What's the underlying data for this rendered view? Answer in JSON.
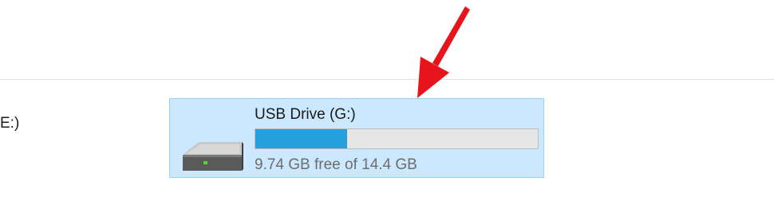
{
  "previous_drive": {
    "label": "E:)"
  },
  "drive": {
    "name": "USB Drive (G:)",
    "free_text": "9.74 GB free of 14.4 GB",
    "used_fraction": 0.3236,
    "icon": "removable-drive-icon"
  },
  "colors": {
    "selection_background": "#cce8ff",
    "selection_border": "#99d1ff",
    "bar_fill": "#26a0da",
    "bar_track": "#e6e6e6",
    "arrow": "#e8141b"
  },
  "annotation": {
    "icon": "red-arrow-icon"
  }
}
